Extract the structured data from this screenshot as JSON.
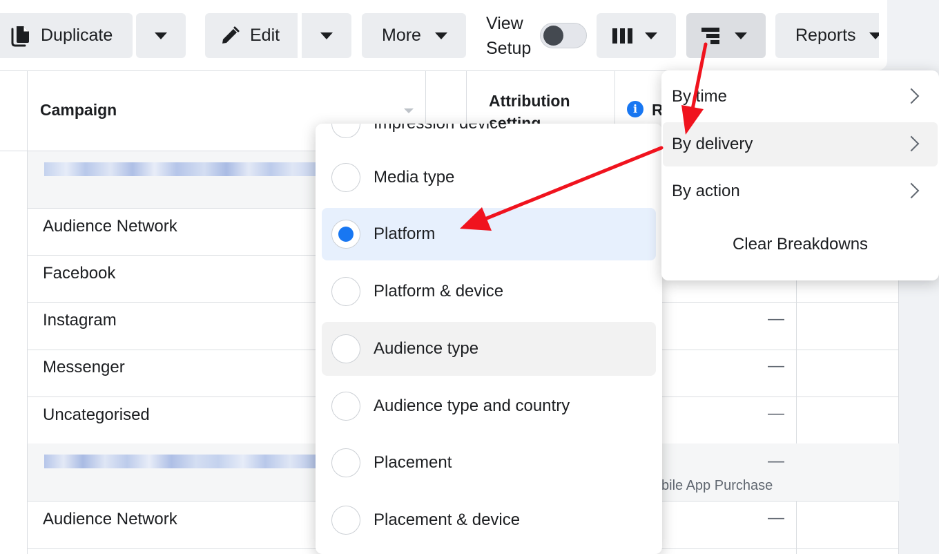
{
  "toolbar": {
    "duplicate_label": "Duplicate",
    "edit_label": "Edit",
    "more_label": "More",
    "view_setup_label": "View Setup",
    "reports_label": "Reports"
  },
  "table": {
    "headers": {
      "campaign": "Campaign",
      "attribution": "Attribution setting",
      "results_initial": "R"
    },
    "rows": [
      {
        "name": "Audience Network"
      },
      {
        "name": "Facebook"
      },
      {
        "name": "Instagram"
      },
      {
        "name": "Messenger"
      },
      {
        "name": "Uncategorised"
      },
      {
        "name": "Audience Network"
      }
    ],
    "dash": "—",
    "result_subtext": "bile App Purchase"
  },
  "breakdown_options": {
    "items": [
      {
        "label": "Impression device",
        "selected": false
      },
      {
        "label": "Media type",
        "selected": false
      },
      {
        "label": "Platform",
        "selected": true
      },
      {
        "label": "Platform & device",
        "selected": false
      },
      {
        "label": "Audience type",
        "selected": false
      },
      {
        "label": "Audience type and country",
        "selected": false
      },
      {
        "label": "Placement",
        "selected": false
      },
      {
        "label": "Placement & device",
        "selected": false
      }
    ]
  },
  "breakdown_menu": {
    "items": [
      {
        "label": "By time"
      },
      {
        "label": "By delivery"
      },
      {
        "label": "By action"
      }
    ],
    "clear_label": "Clear Breakdowns"
  },
  "colors": {
    "accent": "#1877f2",
    "annotation_arrow": "#f0131e",
    "selected_bg": "#e7f0fd",
    "button_bg": "#ebedf0"
  }
}
